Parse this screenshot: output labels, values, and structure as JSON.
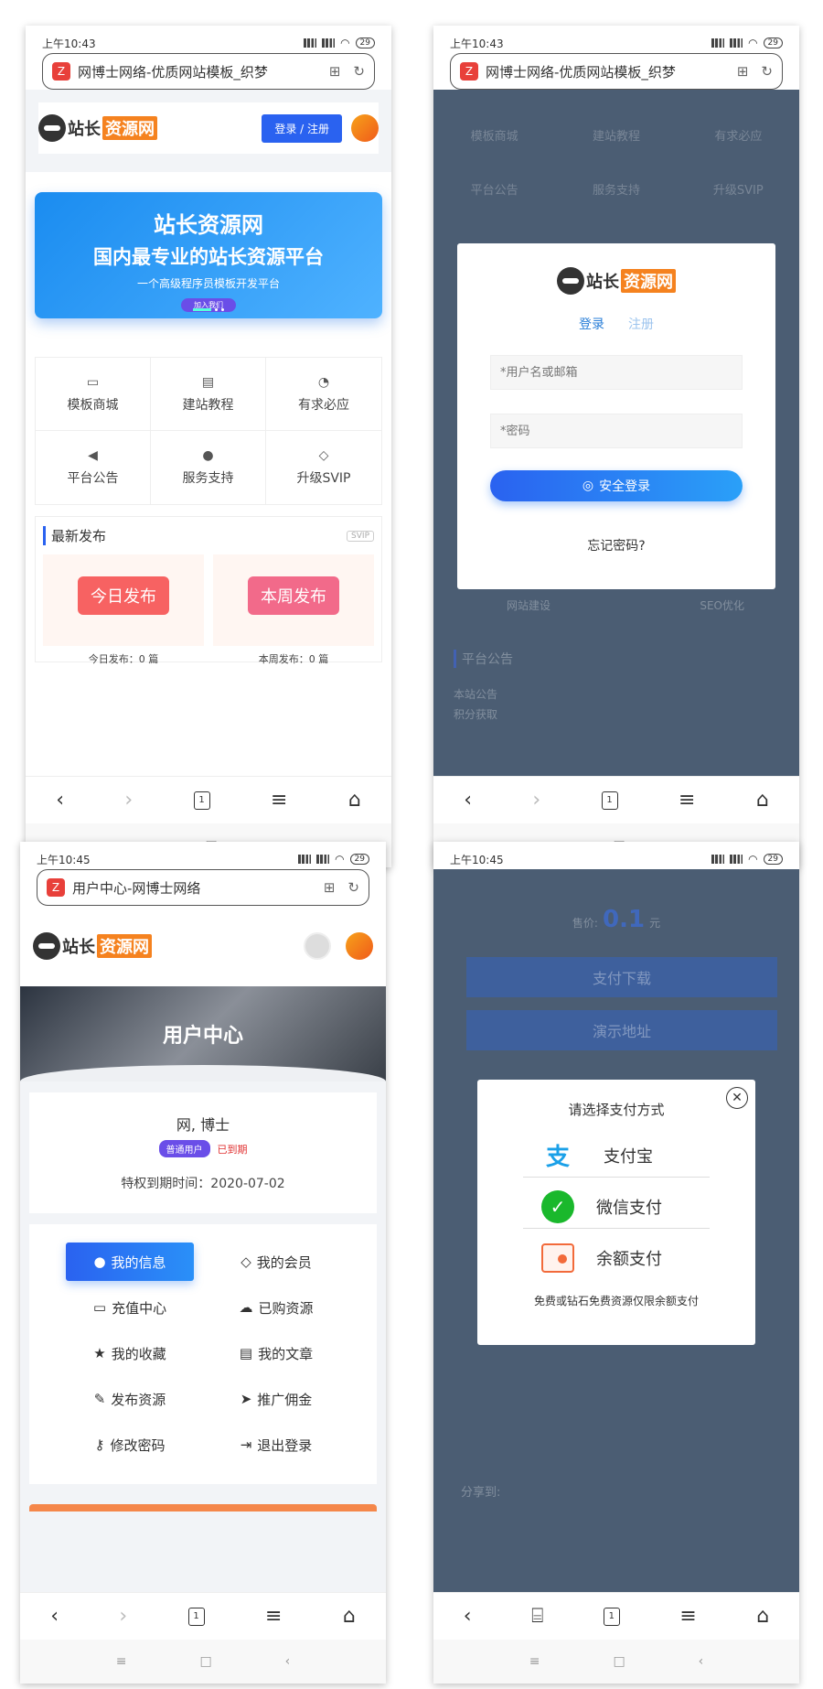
{
  "common": {
    "time1": "上午10:43",
    "time2": "上午10:45",
    "battery": "29",
    "tab_count": "1"
  },
  "phone1": {
    "url": "网博士网络-优质网站模板_织梦",
    "login_button": "登录 / 注册",
    "banner": {
      "title": "站长资源网",
      "subtitle": "国内最专业的站长资源平台",
      "tagline": "一个高级程序员模板开发平台",
      "cta": "加入我们"
    },
    "grid": [
      {
        "icon": "monitor-icon",
        "glyph": "▭",
        "label": "模板商城"
      },
      {
        "icon": "book-icon",
        "glyph": "▤",
        "label": "建站教程"
      },
      {
        "icon": "chat-icon",
        "glyph": "◔",
        "label": "有求必应"
      },
      {
        "icon": "megaphone-icon",
        "glyph": "◀",
        "label": "平台公告"
      },
      {
        "icon": "users-icon",
        "glyph": "●",
        "label": "服务支持"
      },
      {
        "icon": "diamond-icon",
        "glyph": "◇",
        "label": "升级SVIP"
      }
    ],
    "latest_title": "最新发布",
    "svip_badge": "SVIP",
    "cards": [
      {
        "badge": "今日发布",
        "count_label": "今日发布：0 篇"
      },
      {
        "badge": "本周发布",
        "count_label": "本周发布：0 篇"
      }
    ]
  },
  "phone2": {
    "tab_login": "登录",
    "tab_register": "注册",
    "username_placeholder": "*用户名或邮箱",
    "password_placeholder": "*密码",
    "submit": "安全登录",
    "forgot": "忘记密码?",
    "bg_grid": [
      "模板商城",
      "建站教程",
      "有求必应",
      "平台公告",
      "服务支持",
      "升级SVIP"
    ],
    "bg_labels": [
      "网站建设",
      "SEO优化"
    ],
    "bg_notice_title": "平台公告",
    "bg_notices": [
      "本站公告",
      "积分获取"
    ]
  },
  "phone3": {
    "url": "用户中心-网博士网络",
    "hero_title": "用户中心",
    "username": "网, 博士",
    "role_badge": "普通用户",
    "expired": "已到期",
    "expiry": "特权到期时间：2020-07-02",
    "menu": [
      {
        "icon": "user-icon",
        "glyph": "●",
        "label": "我的信息",
        "active": true
      },
      {
        "icon": "diamond-icon",
        "glyph": "◇",
        "label": "我的会员",
        "active": false
      },
      {
        "icon": "card-icon",
        "glyph": "▭",
        "label": "充值中心",
        "active": false
      },
      {
        "icon": "cloud-download-icon",
        "glyph": "☁",
        "label": "已购资源",
        "active": false
      },
      {
        "icon": "star-icon",
        "glyph": "★",
        "label": "我的收藏",
        "active": false
      },
      {
        "icon": "document-icon",
        "glyph": "▤",
        "label": "我的文章",
        "active": false
      },
      {
        "icon": "pencil-icon",
        "glyph": "✎",
        "label": "发布资源",
        "active": false
      },
      {
        "icon": "send-icon",
        "glyph": "➤",
        "label": "推广佣金",
        "active": false
      },
      {
        "icon": "key-icon",
        "glyph": "⚷",
        "label": "修改密码",
        "active": false
      },
      {
        "icon": "logout-icon",
        "glyph": "⇥",
        "label": "退出登录",
        "active": false
      }
    ]
  },
  "phone4": {
    "price_prefix": "售价:",
    "price": "0.1",
    "price_unit": "元",
    "download_btn": "支付下载",
    "demo_btn": "演示地址",
    "modal_title": "请选择支付方式",
    "methods": [
      {
        "icon": "alipay-icon",
        "label": "支付宝"
      },
      {
        "icon": "wechat-pay-icon",
        "label": "微信支付"
      },
      {
        "icon": "wallet-icon",
        "label": "余额支付"
      }
    ],
    "note": "免费或钻石免费资源仅限余额支付",
    "share_label": "分享到:"
  }
}
